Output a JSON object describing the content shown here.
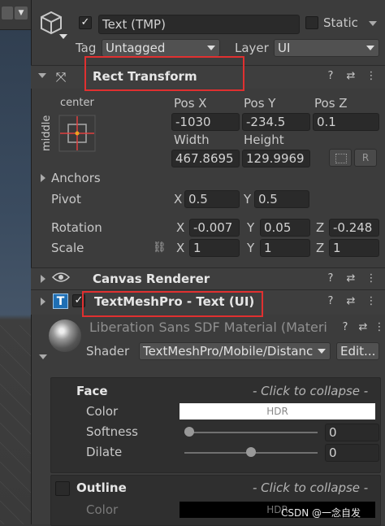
{
  "object": {
    "name": "Text (TMP)",
    "active": true,
    "static_label": "Static",
    "tag_label": "Tag",
    "tag_value": "Untagged",
    "layer_label": "Layer",
    "layer_value": "UI"
  },
  "rect_transform": {
    "title": "Rect Transform",
    "anchor_h": "center",
    "anchor_v": "middle",
    "pos_x_label": "Pos X",
    "pos_y_label": "Pos Y",
    "pos_z_label": "Pos Z",
    "pos_x": "-1030",
    "pos_y": "-234.5",
    "pos_z": "0.1",
    "width_label": "Width",
    "height_label": "Height",
    "width": "467.8695",
    "height": "129.9969",
    "r_button": "R",
    "anchors_label": "Anchors",
    "pivot_label": "Pivot",
    "pivot_x_label": "X",
    "pivot_x": "0.5",
    "pivot_y_label": "Y",
    "pivot_y": "0.5",
    "rotation_label": "Rotation",
    "rot_x_label": "X",
    "rot_x": "-0.007",
    "rot_y_label": "Y",
    "rot_y": "0.05",
    "rot_z_label": "Z",
    "rot_z": "-0.248",
    "scale_label": "Scale",
    "scale_x_label": "X",
    "scale_x": "1",
    "scale_y_label": "Y",
    "scale_y": "1",
    "scale_z_label": "Z",
    "scale_z": "1"
  },
  "canvas_renderer": {
    "title": "Canvas Renderer"
  },
  "textmeshpro": {
    "title": "TextMeshPro - Text (UI)",
    "enabled": true
  },
  "material": {
    "name": "Liberation Sans SDF Material (Materi",
    "shader_label": "Shader",
    "shader_value": "TextMeshPro/Mobile/Distanc",
    "edit_button": "Edit..."
  },
  "face": {
    "title": "Face",
    "collapse_hint": "- Click to collapse -",
    "color_label": "Color",
    "color_value": "HDR",
    "softness_label": "Softness",
    "softness_value": "0",
    "softness_level": 0.0,
    "dilate_label": "Dilate",
    "dilate_value": "0",
    "dilate_level": 0.5
  },
  "outline": {
    "title": "Outline",
    "collapse_hint": "- Click to collapse -",
    "color_label": "Color",
    "color_value": "HDR"
  },
  "watermark": "CSDN @一念自发",
  "colors": {
    "red_highlight": "#e03030",
    "panel_bg": "#3c3c3c",
    "field_bg": "#2a2a2a"
  }
}
